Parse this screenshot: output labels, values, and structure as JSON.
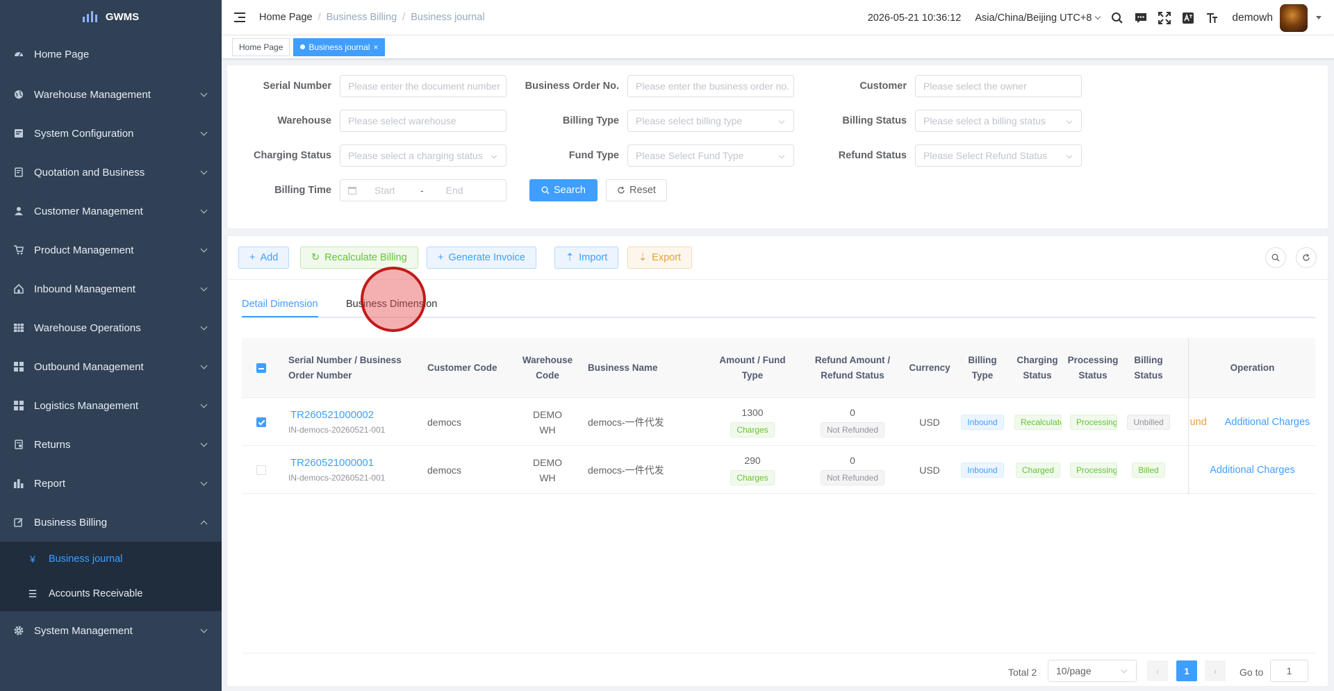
{
  "app": {
    "logo_text": "GWMS"
  },
  "sidebar": {
    "items": [
      {
        "label": "Home Page",
        "icon": "dashboard-icon",
        "expandable": false
      },
      {
        "label": "Warehouse Management",
        "icon": "globe-icon",
        "expandable": true
      },
      {
        "label": "System Configuration",
        "icon": "config-icon",
        "expandable": true
      },
      {
        "label": "Quotation and Business",
        "icon": "quotation-icon",
        "expandable": true
      },
      {
        "label": "Customer Management",
        "icon": "user-icon",
        "expandable": true
      },
      {
        "label": "Product Management",
        "icon": "cart-icon",
        "expandable": true
      },
      {
        "label": "Inbound Management",
        "icon": "home-icon",
        "expandable": true
      },
      {
        "label": "Warehouse Operations",
        "icon": "grid-icon",
        "expandable": true
      },
      {
        "label": "Outbound Management",
        "icon": "tiles-icon",
        "expandable": true
      },
      {
        "label": "Logistics Management",
        "icon": "tiles-icon",
        "expandable": true
      },
      {
        "label": "Returns",
        "icon": "returns-icon",
        "expandable": true
      },
      {
        "label": "Report",
        "icon": "chart-icon",
        "expandable": true
      },
      {
        "label": "Business Billing",
        "icon": "edit-icon",
        "expandable": true,
        "expanded": true
      }
    ],
    "sub_items": [
      {
        "label": "Business journal",
        "icon": "yen-icon",
        "active": true
      },
      {
        "label": "Accounts Receivable",
        "icon": "list-icon",
        "active": false
      }
    ],
    "bottom_item": {
      "label": "System Management",
      "icon": "gear-icon"
    }
  },
  "header": {
    "breadcrumb": [
      "Home Page",
      "Business Billing",
      "Business journal"
    ],
    "datetime": "2026-05-21 10:36:12",
    "timezone": "Asia/China/Beijing UTC+8",
    "username": "demowh"
  },
  "tags": [
    {
      "label": "Home Page",
      "active": false
    },
    {
      "label": "Business journal",
      "active": true
    }
  ],
  "filters": {
    "serial_number": {
      "label": "Serial Number",
      "placeholder": "Please enter the document number"
    },
    "business_order_no": {
      "label": "Business Order No.",
      "placeholder": "Please enter the business order no."
    },
    "customer": {
      "label": "Customer",
      "placeholder": "Please select the owner"
    },
    "warehouse": {
      "label": "Warehouse",
      "placeholder": "Please select warehouse"
    },
    "billing_type": {
      "label": "Billing Type",
      "placeholder": "Please select billing type"
    },
    "billing_status": {
      "label": "Billing Status",
      "placeholder": "Please select a billing status"
    },
    "charging_status": {
      "label": "Charging Status",
      "placeholder": "Please select a charging status"
    },
    "fund_type": {
      "label": "Fund Type",
      "placeholder": "Please Select Fund Type"
    },
    "refund_status": {
      "label": "Refund Status",
      "placeholder": "Please Select Refund Status"
    },
    "billing_time": {
      "label": "Billing Time",
      "start": "Start",
      "separator": "-",
      "end": "End"
    },
    "search_label": "Search",
    "reset_label": "Reset"
  },
  "toolbar": {
    "add": "Add",
    "recalculate": "Recalculate Billing",
    "generate_invoice": "Generate Invoice",
    "import": "Import",
    "export": "Export"
  },
  "tabs": [
    {
      "label": "Detail Dimension",
      "active": true
    },
    {
      "label": "Business Dimension",
      "active": false
    }
  ],
  "table": {
    "headers": {
      "serial": "Serial Number / Business Order Number",
      "customer_code": "Customer Code",
      "warehouse_code": "Warehouse Code",
      "business_name": "Business Name",
      "amount": "Amount / Fund Type",
      "refund": "Refund Amount / Refund Status",
      "currency": "Currency",
      "billing_type": "Billing Type",
      "charging_status": "Charging Status",
      "processing_status": "Processing Status",
      "billing_status": "Billing Status",
      "operation": "Operation"
    },
    "rows": [
      {
        "checked": true,
        "serial": "TR260521000002",
        "order": "IN-democs-20260521-001",
        "customer_code": "democs",
        "warehouse_code": "DEMOWH",
        "business_name": "democs-一件代发",
        "amount": "1300",
        "fund_type": "Charges",
        "refund_amount": "0",
        "refund_status": "Not Refunded",
        "currency": "USD",
        "billing_type": "Inbound",
        "charging_status": "Recalculate",
        "processing_status": "Processing",
        "billing_status": "Unbilled",
        "op_refund": "Refund",
        "op_additional": "Additional Charges"
      },
      {
        "checked": false,
        "serial": "TR260521000001",
        "order": "IN-democs-20260521-001",
        "customer_code": "democs",
        "warehouse_code": "DEMOWH",
        "business_name": "democs-一件代发",
        "amount": "290",
        "fund_type": "Charges",
        "refund_amount": "0",
        "refund_status": "Not Refunded",
        "currency": "USD",
        "billing_type": "Inbound",
        "charging_status": "Charged",
        "processing_status": "Processing",
        "billing_status": "Billed",
        "op_additional": "Additional Charges"
      }
    ]
  },
  "pagination": {
    "total": "Total 2",
    "page_size": "10/page",
    "current_page": "1",
    "goto_label": "Go to",
    "goto_value": "1"
  }
}
